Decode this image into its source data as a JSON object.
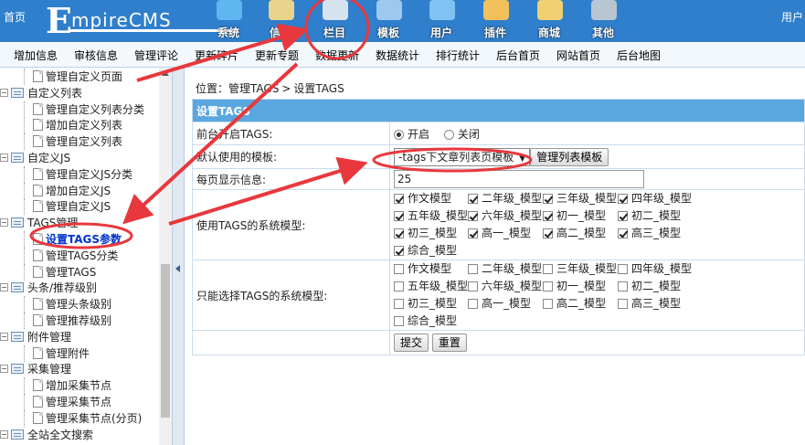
{
  "top": {
    "home": "首页",
    "logo_e": "E",
    "logo_rest": "mpireCMS",
    "user": "用户",
    "nav": [
      {
        "label": "系统",
        "icon": "globe-icon",
        "color": "#5fb6f0"
      },
      {
        "label": "信息",
        "icon": "notepad-icon",
        "color": "#e8d48a"
      },
      {
        "label": "栏目",
        "icon": "folder-icon",
        "color": "#d6e3ef"
      },
      {
        "label": "模板",
        "icon": "template-icon",
        "color": "#9ec9ee"
      },
      {
        "label": "用户",
        "icon": "user-icon",
        "color": "#7fc3f3"
      },
      {
        "label": "插件",
        "icon": "plugin-icon",
        "color": "#f2c15c"
      },
      {
        "label": "商城",
        "icon": "shop-icon",
        "color": "#f0d070"
      },
      {
        "label": "其他",
        "icon": "gear-icon",
        "color": "#b8c6d2"
      }
    ]
  },
  "subnav": [
    "增加信息",
    "审核信息",
    "管理评论",
    "更新碎片",
    "更新专题",
    "数据更新",
    "数据统计",
    "排行统计",
    "后台首页",
    "网站首页",
    "后台地图"
  ],
  "sidebar": [
    {
      "type": "leaf",
      "label": "管理自定义页面"
    },
    {
      "type": "cat",
      "label": "自定义列表"
    },
    {
      "type": "leaf",
      "label": "管理自定义列表分类"
    },
    {
      "type": "leaf",
      "label": "增加自定义列表"
    },
    {
      "type": "leaf",
      "label": "管理自定义列表"
    },
    {
      "type": "cat",
      "label": "自定义JS"
    },
    {
      "type": "leaf",
      "label": "管理自定义JS分类"
    },
    {
      "type": "leaf",
      "label": "增加自定义JS"
    },
    {
      "type": "leaf",
      "label": "管理自定义JS"
    },
    {
      "type": "cat",
      "label": "TAGS管理"
    },
    {
      "type": "leaf",
      "label": "设置TAGS参数",
      "active": true
    },
    {
      "type": "leaf",
      "label": "管理TAGS分类"
    },
    {
      "type": "leaf",
      "label": "管理TAGS"
    },
    {
      "type": "cat",
      "label": "头条/推荐级别"
    },
    {
      "type": "leaf",
      "label": "管理头条级别"
    },
    {
      "type": "leaf",
      "label": "管理推荐级别"
    },
    {
      "type": "cat",
      "label": "附件管理"
    },
    {
      "type": "leaf",
      "label": "管理附件"
    },
    {
      "type": "cat",
      "label": "采集管理"
    },
    {
      "type": "leaf",
      "label": "增加采集节点"
    },
    {
      "type": "leaf",
      "label": "管理采集节点"
    },
    {
      "type": "leaf",
      "label": "管理采集节点(分页)"
    },
    {
      "type": "cat",
      "label": "全站全文搜索"
    }
  ],
  "breadcrumb": {
    "prefix": "位置：",
    "items": [
      "管理TAGS",
      "设置TAGS"
    ],
    "sep": ">"
  },
  "form": {
    "header": "设置TAGS",
    "enable_label": "前台开启TAGS:",
    "enable_on": "开启",
    "enable_off": "关闭",
    "enable_value": "on",
    "template_label": "默认使用的模板:",
    "template_value": "-tags下文章列表页模板",
    "template_button": "管理列表模板",
    "perpage_label": "每页显示信息:",
    "perpage_value": "25",
    "use_models_label": "使用TAGS的系统模型:",
    "only_models_label": "只能选择TAGS的系统模型:",
    "models": [
      "作文模型",
      "二年级_模型",
      "三年级_模型",
      "四年级_模型",
      "五年级_模型",
      "六年级_模型",
      "初一_模型",
      "初二_模型",
      "初三_模型",
      "高一_模型",
      "高二_模型",
      "高三_模型",
      "综合_模型"
    ],
    "use_models_checked": [
      true,
      true,
      true,
      true,
      true,
      true,
      true,
      true,
      true,
      true,
      true,
      true,
      true
    ],
    "only_models_checked": [
      false,
      false,
      false,
      false,
      false,
      false,
      false,
      false,
      false,
      false,
      false,
      false,
      false
    ],
    "submit": "提交",
    "reset": "重置"
  }
}
